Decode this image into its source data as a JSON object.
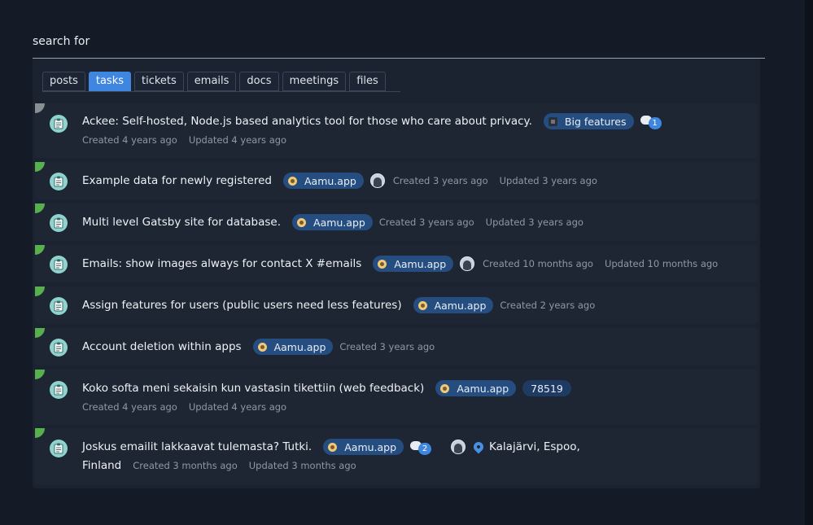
{
  "search": {
    "label": "search for"
  },
  "tabs": [
    "posts",
    "tasks",
    "tickets",
    "emails",
    "docs",
    "meetings",
    "files"
  ],
  "active_tab": "tasks",
  "colors": {
    "accent": "#3f86e0",
    "status_open": "#57b04d",
    "status_gray": "#8a8f96",
    "badge": "#264d80"
  },
  "rows": [
    {
      "title": "Ackee: Self-hosted, Node.js based analytics tool for those who care about privacy.",
      "badge": "Big features",
      "comments": "1",
      "created": "Created 4 years ago",
      "updated": "Updated 4 years ago"
    },
    {
      "title": "Example data for newly registered",
      "badge": "Aamu.app",
      "created": "Created 3 years ago",
      "updated": "Updated 3 years ago"
    },
    {
      "title": "Multi level Gatsby site for database.",
      "badge": "Aamu.app",
      "created": "Created 3 years ago",
      "updated": "Updated 3 years ago"
    },
    {
      "title": "Emails: show images always for contact X #emails",
      "badge": "Aamu.app",
      "created": "Created 10 months ago",
      "updated": "Updated 10 months ago"
    },
    {
      "title": "Assign features for users (public users need less features)",
      "badge": "Aamu.app",
      "created": "Created 2 years ago"
    },
    {
      "title": "Account deletion within apps",
      "badge": "Aamu.app",
      "created": "Created 3 years ago"
    },
    {
      "title": "Koko softa meni sekaisin kun vastasin tikettiin (web feedback)",
      "badge": "Aamu.app",
      "number": "78519",
      "created": "Created 4 years ago",
      "updated": "Updated 4 years ago"
    },
    {
      "title": "Joskus emailit lakkaavat tulemasta? Tutki.",
      "badge": "Aamu.app",
      "comments": "2",
      "location_1": "Kalajärvi, Espoo,",
      "location_2": "Finland",
      "created": "Created 3 months ago",
      "updated": "Updated 3 months ago"
    }
  ]
}
